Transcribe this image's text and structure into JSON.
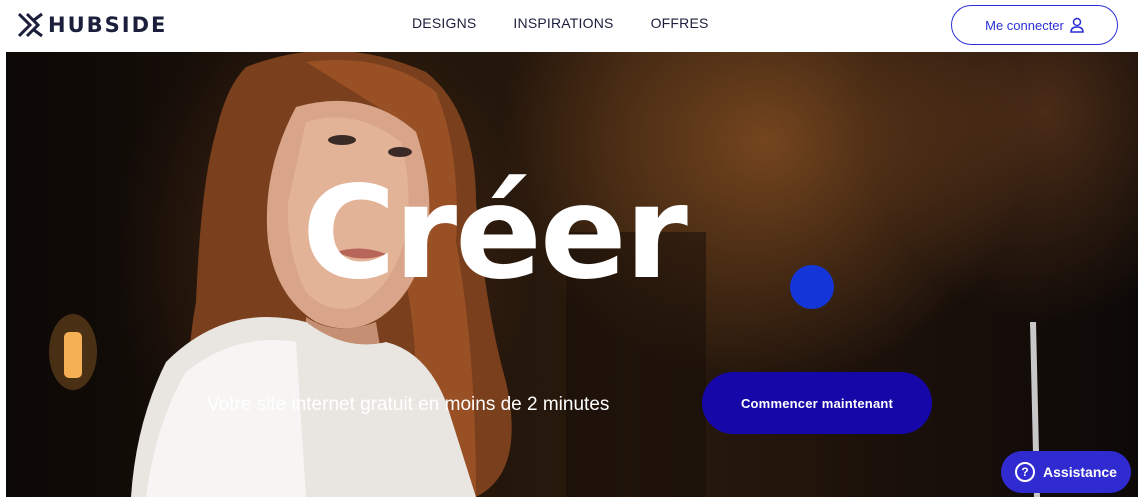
{
  "brand": {
    "name": "HUBSIDE",
    "logo_icon": "double-chevron-x-icon"
  },
  "nav": {
    "items": [
      {
        "label": "DESIGNS"
      },
      {
        "label": "INSPIRATIONS"
      },
      {
        "label": "OFFRES"
      }
    ]
  },
  "header": {
    "login_label": "Me connecter",
    "login_icon": "user-icon"
  },
  "hero": {
    "title": "Créer",
    "subtitle": "Votre site internet gratuit en moins de 2 minutes",
    "cta_label": "Commencer maintenant",
    "background_image": "woman-portrait-photo"
  },
  "assistance": {
    "label": "Assistance",
    "icon": "question-circle-icon"
  },
  "colors": {
    "accent": "#2a2fd6",
    "cta": "#1608a8",
    "dot": "#1436d8",
    "text_dark": "#1b1f3b"
  }
}
